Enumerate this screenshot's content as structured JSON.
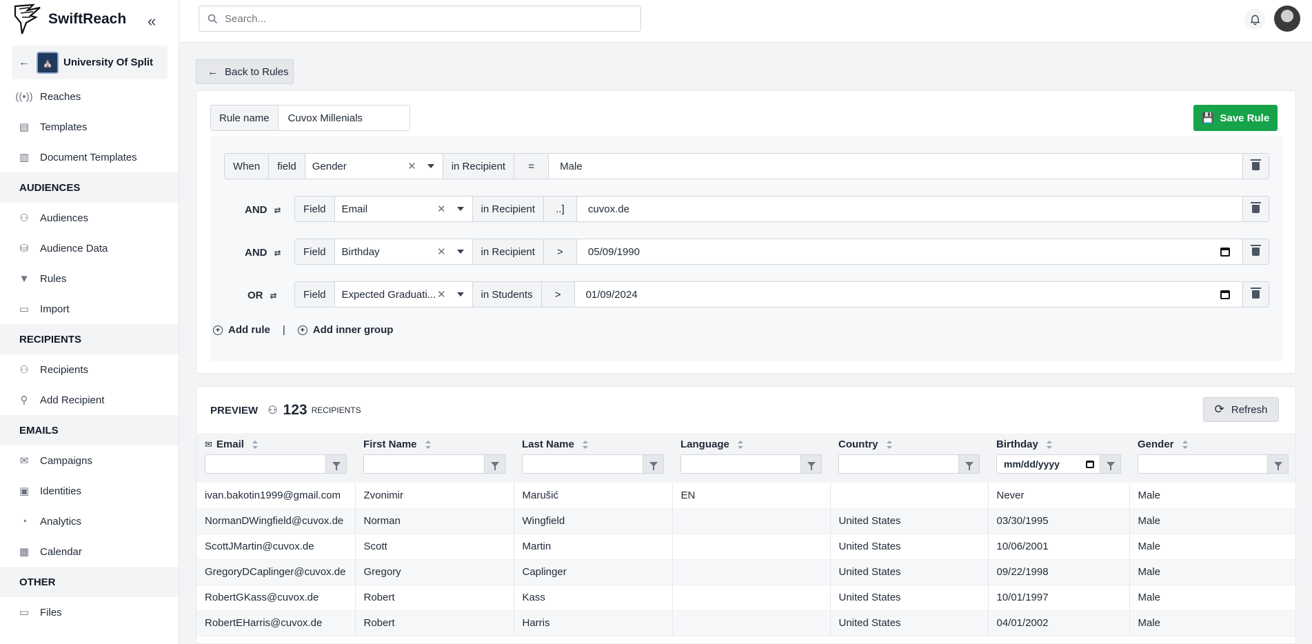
{
  "app": {
    "name": "SwiftReach"
  },
  "org": {
    "name": "University Of Split"
  },
  "sidebar": {
    "top_items": [
      {
        "label": "Reaches",
        "icon": "broadcast-icon"
      },
      {
        "label": "Templates",
        "icon": "template-icon"
      },
      {
        "label": "Document Templates",
        "icon": "clipboard-icon"
      }
    ],
    "sections": [
      {
        "title": "AUDIENCES",
        "items": [
          {
            "label": "Audiences",
            "icon": "users-icon"
          },
          {
            "label": "Audience Data",
            "icon": "database-icon"
          },
          {
            "label": "Rules",
            "icon": "filter-icon"
          },
          {
            "label": "Import",
            "icon": "folder-icon"
          }
        ]
      },
      {
        "title": "RECIPIENTS",
        "items": [
          {
            "label": "Recipients",
            "icon": "users-icon"
          },
          {
            "label": "Add Recipient",
            "icon": "user-plus-icon"
          }
        ]
      },
      {
        "title": "EMAILS",
        "items": [
          {
            "label": "Campaigns",
            "icon": "envelope-icon"
          },
          {
            "label": "Identities",
            "icon": "id-card-icon"
          },
          {
            "label": "Analytics",
            "icon": "pie-chart-icon"
          },
          {
            "label": "Calendar",
            "icon": "calendar-icon"
          }
        ]
      },
      {
        "title": "OTHER",
        "items": [
          {
            "label": "Files",
            "icon": "folder-icon"
          }
        ]
      }
    ]
  },
  "search": {
    "placeholder": "Search..."
  },
  "back_button": {
    "label": "Back to Rules"
  },
  "rule": {
    "name_label": "Rule name",
    "name_value": "Cuvox Millenials",
    "save_label": "Save Rule",
    "when_label": "When",
    "first": {
      "field_label": "field",
      "field": "Gender",
      "scope": "in Recipient",
      "operator": "=",
      "value": "Male"
    },
    "conditions": [
      {
        "conj": "AND",
        "field_label": "Field",
        "field": "Email",
        "scope": "in Recipient",
        "operator": "..]",
        "value": "cuvox.de"
      },
      {
        "conj": "AND",
        "field_label": "Field",
        "field": "Birthday",
        "scope": "in Recipient",
        "operator": ">",
        "value": "05/09/1990"
      },
      {
        "conj": "OR",
        "field_label": "Field",
        "field": "Expected Graduati...",
        "scope": "in Students",
        "operator": ">",
        "value": "01/09/2024"
      }
    ],
    "add_rule_label": "Add rule",
    "separator": "|",
    "add_group_label": "Add inner group"
  },
  "preview": {
    "title": "PREVIEW",
    "count": "123",
    "count_label": "RECIPIENTS",
    "refresh_label": "Refresh",
    "date_placeholder": "mm/dd/yyyy",
    "columns": [
      "Email",
      "First Name",
      "Last Name",
      "Language",
      "Country",
      "Birthday",
      "Gender"
    ],
    "rows": [
      [
        "ivan.bakotin1999@gmail.com",
        "Zvonimir",
        "Marušić",
        "EN",
        "",
        "Never",
        "Male"
      ],
      [
        "NormanDWingfield@cuvox.de",
        "Norman",
        "Wingfield",
        "",
        "United States",
        "03/30/1995",
        "Male"
      ],
      [
        "ScottJMartin@cuvox.de",
        "Scott",
        "Martin",
        "",
        "United States",
        "10/06/2001",
        "Male"
      ],
      [
        "GregoryDCaplinger@cuvox.de",
        "Gregory",
        "Caplinger",
        "",
        "United States",
        "09/22/1998",
        "Male"
      ],
      [
        "RobertGKass@cuvox.de",
        "Robert",
        "Kass",
        "",
        "United States",
        "10/01/1997",
        "Male"
      ],
      [
        "RobertEHarris@cuvox.de",
        "Robert",
        "Harris",
        "",
        "United States",
        "04/01/2002",
        "Male"
      ]
    ]
  }
}
